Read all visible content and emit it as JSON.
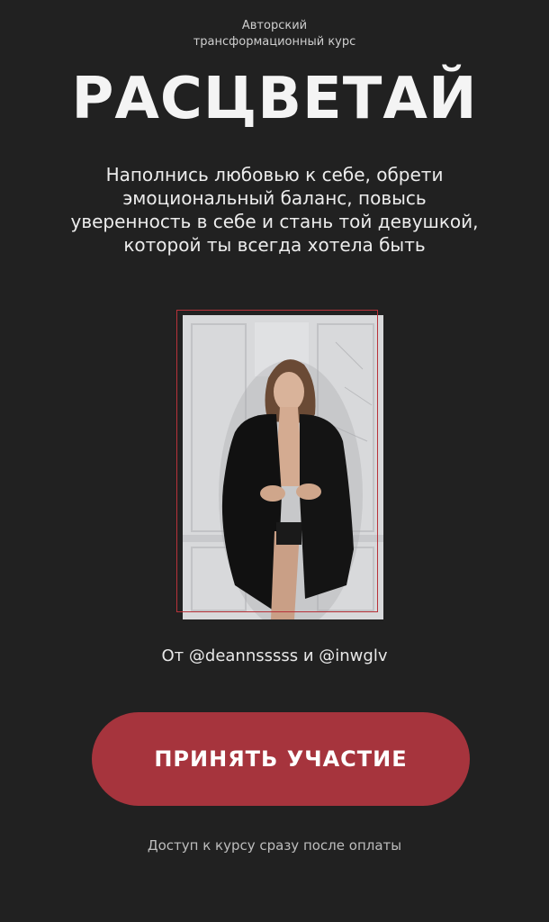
{
  "header": {
    "eyebrow_line1": "Авторский",
    "eyebrow_line2": "трансформационный курс",
    "title": "РАСЦВЕТАЙ"
  },
  "lead": {
    "line1": "Наполнись любовью к себе, обрети",
    "line2": "эмоциональный баланс, повысь",
    "line3": "уверенность в себе и стань той девушкой,",
    "line4": "которой ты всегда хотела быть"
  },
  "photo": {
    "frame_color": "#b8323a",
    "subject": "woman in black blazer against white paneled wall"
  },
  "credits": "От @deannsssss и @inwglv",
  "cta": {
    "label": "ПРИНЯТЬ УЧАСТИЕ",
    "color": "#a6343d"
  },
  "footnote": "Доступ к курсу сразу после оплаты",
  "colors": {
    "background": "#212121",
    "accent": "#a6343d",
    "text": "#f2f2f2"
  }
}
